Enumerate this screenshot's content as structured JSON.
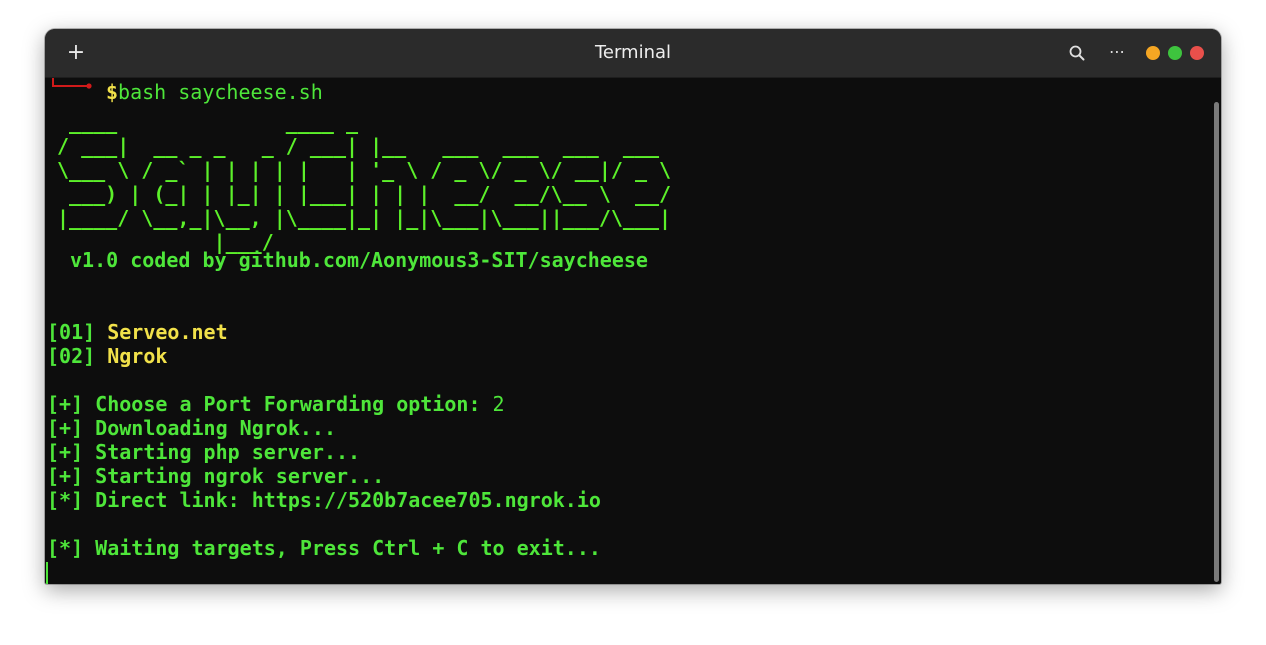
{
  "window": {
    "title": "Terminal",
    "new_tab_icon": "plus-icon",
    "search_icon": "search-icon",
    "menu_icon": "more-horizontal-icon",
    "menu_label": "⋯",
    "controls": {
      "minimize_color": "#f5a623",
      "maximize_color": "#3ec43e",
      "close_color": "#e9504b"
    }
  },
  "terminal": {
    "prompt_symbol": "$",
    "command": "bash saycheese.sh",
    "banner_ascii": " ____              ____ _\n/ ___|  __ _ _   _ / ___| |__   ___  ___  ___  ___\n\\___ \\ / _` | | | | |   | '_ \\ / _ \\/ _ \\/ __|/ _ \\\n ___) | (_| | |_| | |___| | | |  __/  __/\\__ \\  __/\n|____/ \\__,_|\\__, |\\____|_| |_|\\___|\\___||___/\\___|\n             |___/",
    "banner_credit": "v1.0 coded by github.com/Aonymous3-SIT/saycheese",
    "options": [
      {
        "index": "[01]",
        "label": "Serveo.net"
      },
      {
        "index": "[02]",
        "label": "Ngrok"
      }
    ],
    "log": [
      {
        "prefix": "[+]",
        "text": "Choose a Port Forwarding option:",
        "value": "2"
      },
      {
        "prefix": "[+]",
        "text": "Downloading Ngrok..."
      },
      {
        "prefix": "[+]",
        "text": "Starting php server..."
      },
      {
        "prefix": "[+]",
        "text": "Starting ngrok server..."
      },
      {
        "prefix": "[*]",
        "text": "Direct link:",
        "value": "https://520b7acee705.ngrok.io"
      },
      {
        "prefix": "[*]",
        "text": "Waiting targets, Press Ctrl + C to exit..."
      }
    ],
    "colors": {
      "background": "#0d0d0d",
      "green": "#4ee63a",
      "bright_green": "#5cf02a",
      "yellow": "#f1e14a",
      "red": "#d11a1a"
    }
  }
}
